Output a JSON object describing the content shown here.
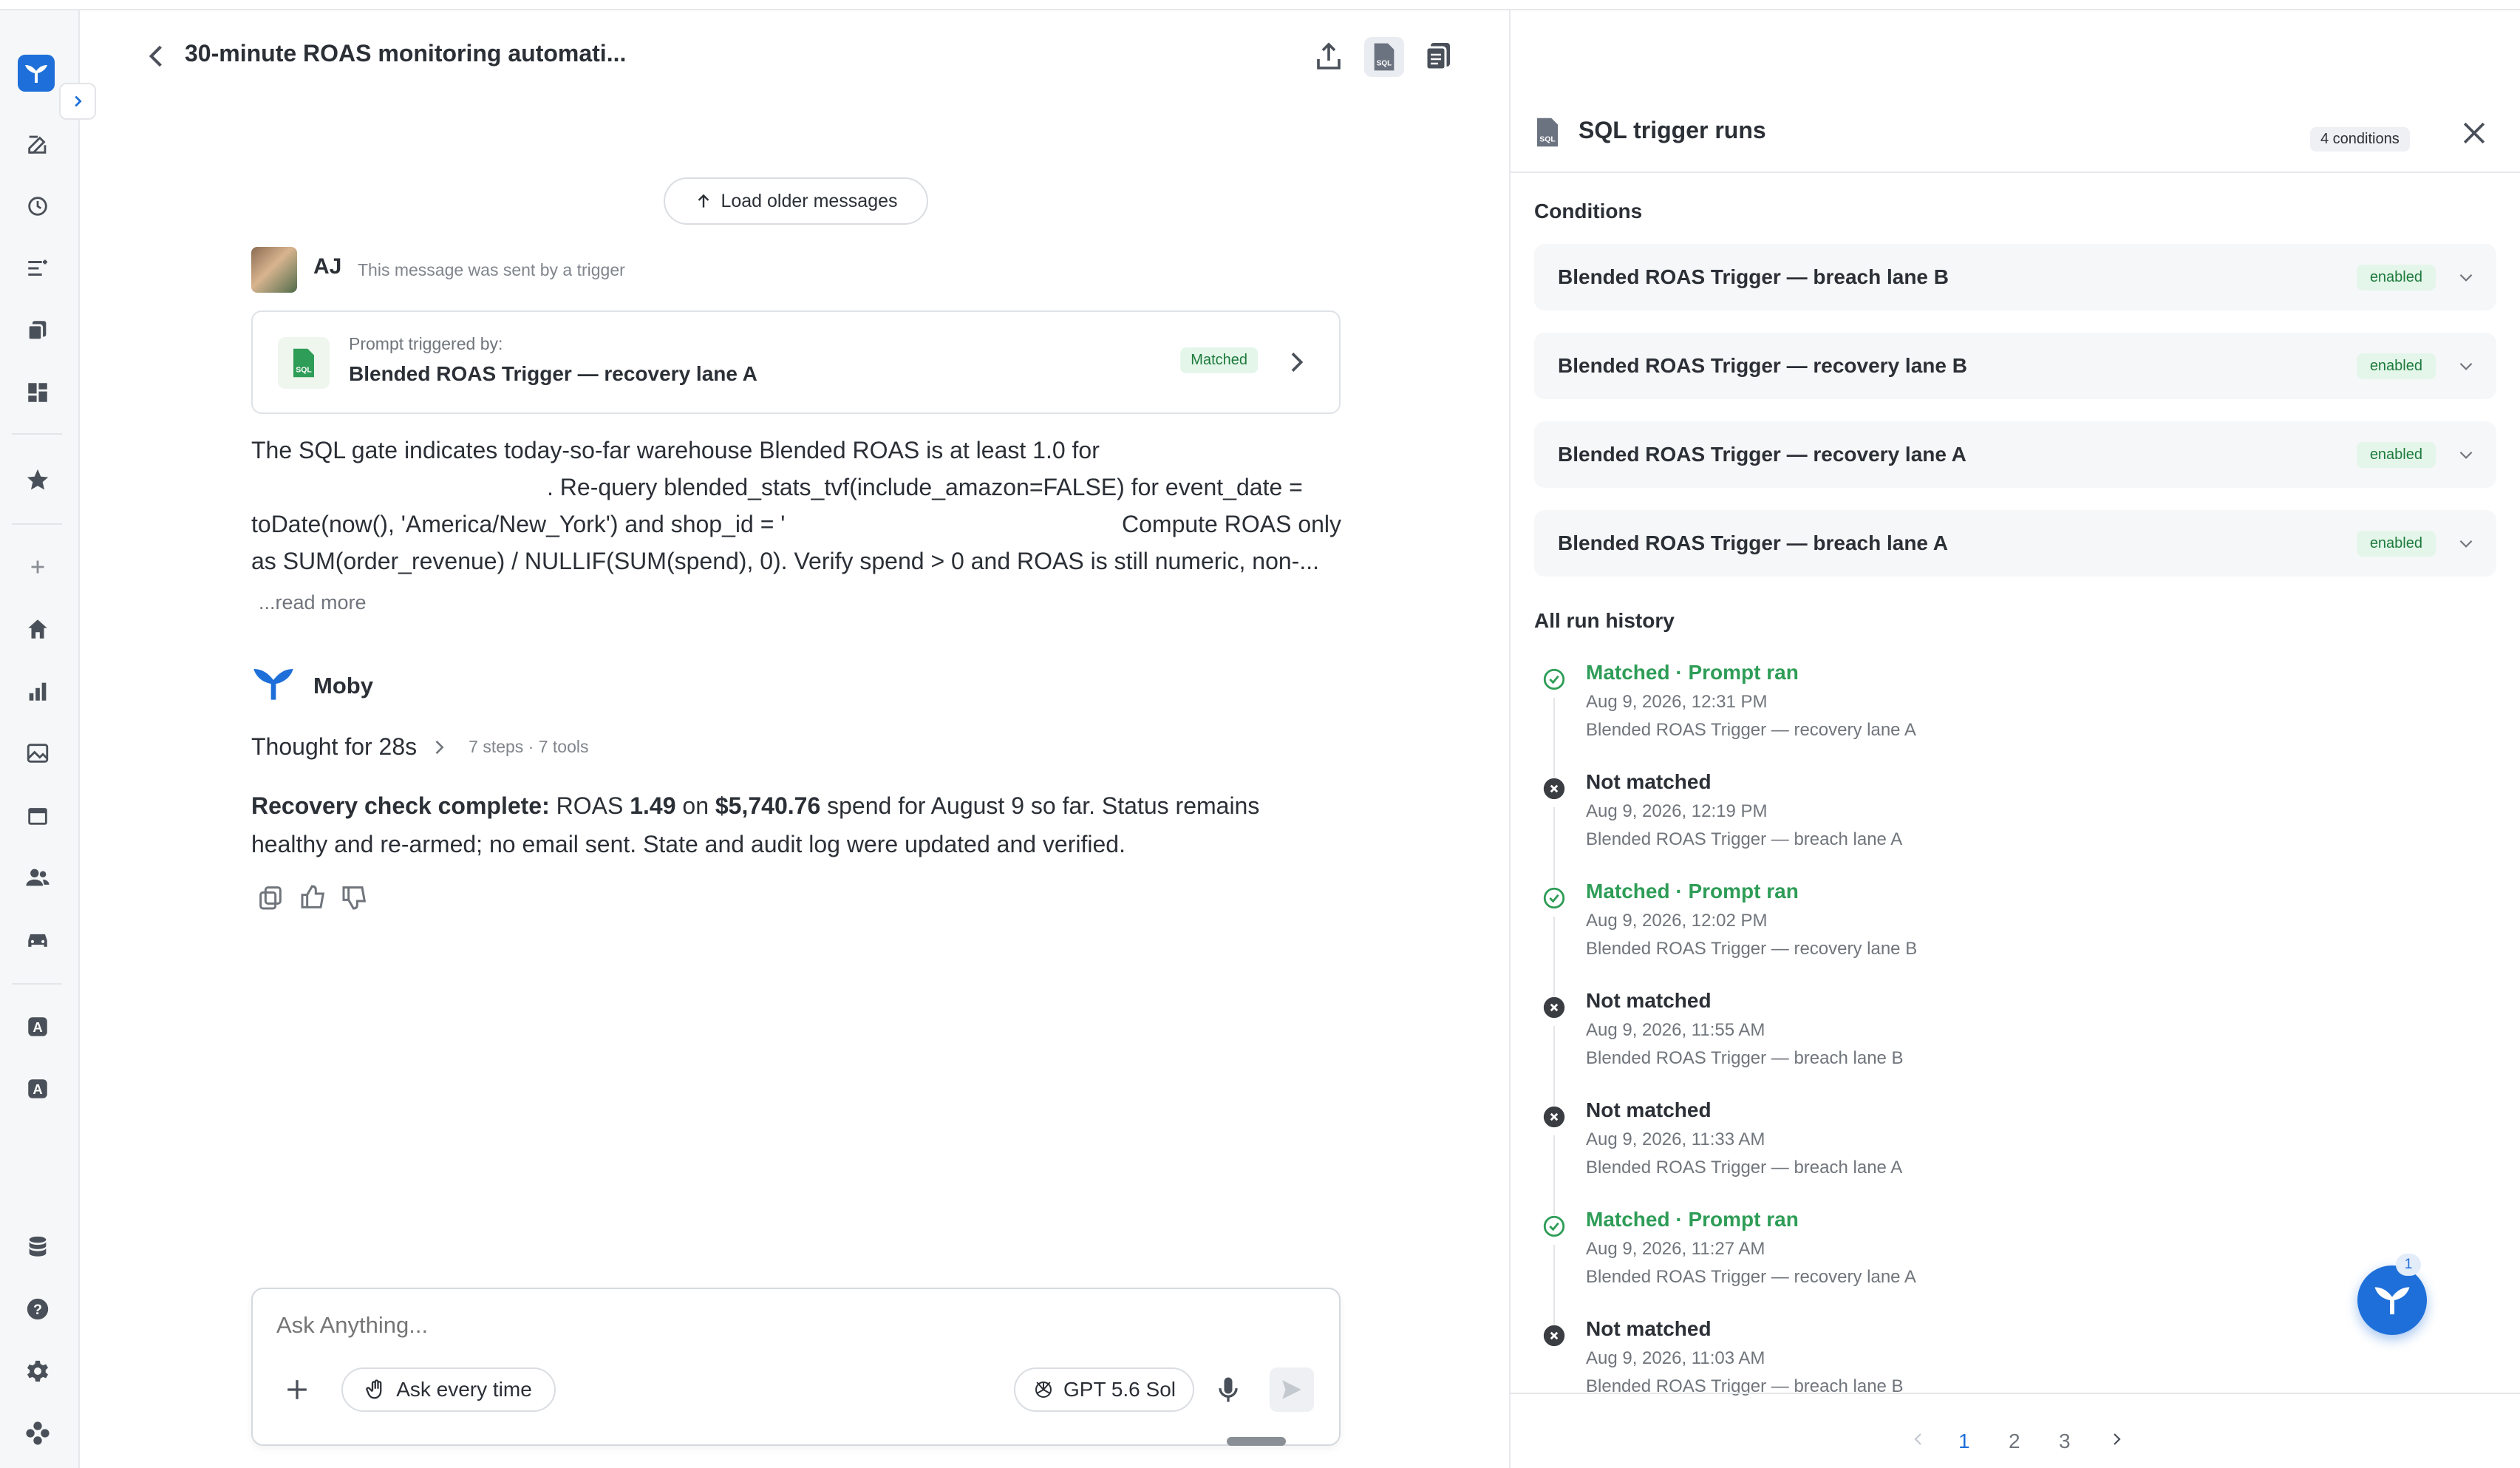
{
  "chat": {
    "title": "30-minute ROAS monitoring automati...",
    "load_older": "Load older messages",
    "user": {
      "initials": "AJ",
      "sent_note": "This message was sent by a trigger",
      "trigger_card": {
        "label": "Prompt triggered by:",
        "name": "Blended ROAS Trigger — recovery lane A",
        "status": "Matched"
      },
      "message_lines": [
        "The SQL gate indicates today-so-far warehouse Blended ROAS is at least 1.0 for",
        ". Re-query blended_stats_tvf(include_amazon=FALSE) for event_date =",
        "toDate(now(), 'America/New_York') and shop_id = '",
        "Compute ROAS only",
        "as SUM(order_revenue) / NULLIF(SUM(spend), 0). Verify spend > 0 and ROAS is still numeric, non-..."
      ],
      "read_more": "...read more"
    },
    "assistant": {
      "name": "Moby",
      "thought": "Thought for 28s",
      "steps": "7 steps · 7 tools",
      "lead": "Recovery check complete:",
      "t1": " ROAS ",
      "roas": "1.49",
      "t2": " on ",
      "spend": "$5,740.76",
      "t3": " spend for August 9 so far. Status remains",
      "line2": "healthy and re-armed; no email sent. State and audit log were updated and verified."
    },
    "composer": {
      "placeholder": "Ask Anything...",
      "permission": "Ask every time",
      "model": "GPT 5.6 Sol"
    }
  },
  "panel": {
    "title": "SQL trigger runs",
    "conditions_count": "4 conditions",
    "conditions_heading": "Conditions",
    "conditions": [
      {
        "name": "Blended ROAS Trigger — breach lane B",
        "state": "enabled"
      },
      {
        "name": "Blended ROAS Trigger — recovery lane B",
        "state": "enabled"
      },
      {
        "name": "Blended ROAS Trigger — recovery lane A",
        "state": "enabled"
      },
      {
        "name": "Blended ROAS Trigger — breach lane A",
        "state": "enabled"
      }
    ],
    "history_heading": "All run history",
    "runs": [
      {
        "status": "Matched · Prompt ran",
        "matched": true,
        "date": "Aug 9, 2026, 12:31 PM",
        "trigger": "Blended ROAS Trigger — recovery lane A"
      },
      {
        "status": "Not matched",
        "matched": false,
        "date": "Aug 9, 2026, 12:19 PM",
        "trigger": "Blended ROAS Trigger — breach lane A"
      },
      {
        "status": "Matched · Prompt ran",
        "matched": true,
        "date": "Aug 9, 2026, 12:02 PM",
        "trigger": "Blended ROAS Trigger — recovery lane B"
      },
      {
        "status": "Not matched",
        "matched": false,
        "date": "Aug 9, 2026, 11:55 AM",
        "trigger": "Blended ROAS Trigger — breach lane B"
      },
      {
        "status": "Not matched",
        "matched": false,
        "date": "Aug 9, 2026, 11:33 AM",
        "trigger": "Blended ROAS Trigger — breach lane A"
      },
      {
        "status": "Matched · Prompt ran",
        "matched": true,
        "date": "Aug 9, 2026, 11:27 AM",
        "trigger": "Blended ROAS Trigger — recovery lane A"
      },
      {
        "status": "Not matched",
        "matched": false,
        "date": "Aug 9, 2026, 11:03 AM",
        "trigger": "Blended ROAS Trigger — breach lane B"
      }
    ],
    "pagination": {
      "pages": [
        "1",
        "2",
        "3"
      ],
      "current": "1"
    },
    "fab_badge": "1"
  },
  "colors": {
    "accent": "#1e6fd9",
    "matched": "#2e9d57",
    "not_matched": "#3a3d42",
    "badge_bg": "#e4f6ea"
  },
  "icons": {
    "sidebar": [
      "logo-icon",
      "new-chat-icon",
      "history-icon",
      "filters-icon",
      "copies-icon",
      "dashboard-icon",
      "star-icon",
      "plus-icon",
      "home-icon",
      "chart-icon",
      "image-icon",
      "calendar-icon",
      "users-icon",
      "car-icon",
      "a-app-icon",
      "a-app-2-icon",
      "database-icon",
      "help-icon",
      "settings-icon",
      "integrations-icon"
    ]
  }
}
